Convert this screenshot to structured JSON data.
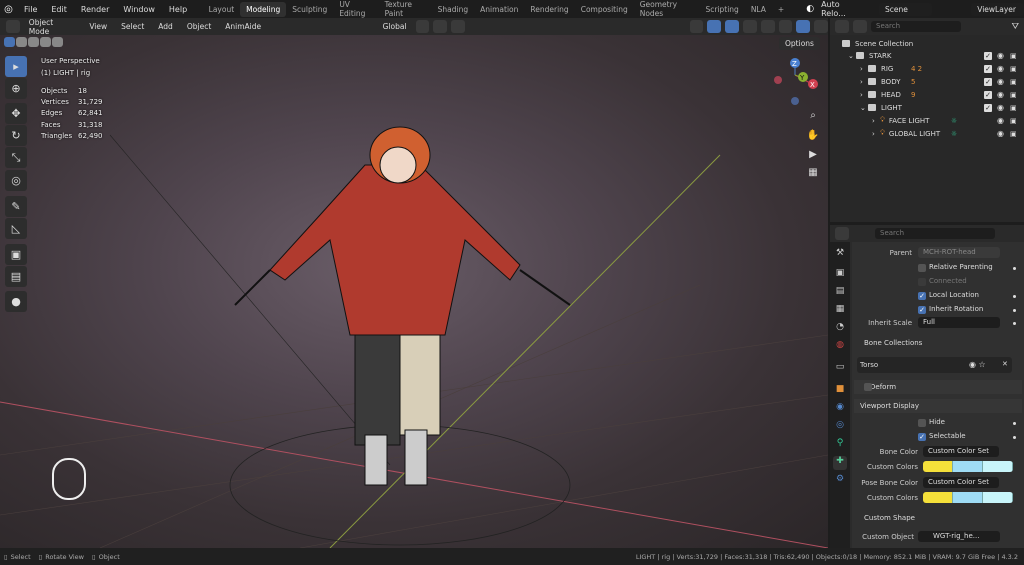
{
  "menu": [
    "File",
    "Edit",
    "Render",
    "Window",
    "Help"
  ],
  "workspaces": [
    "Layout",
    "Modeling",
    "Sculpting",
    "UV Editing",
    "Texture Paint",
    "Shading",
    "Animation",
    "Rendering",
    "Compositing",
    "Geometry Nodes",
    "Scripting",
    "NLA",
    "+"
  ],
  "active_workspace": "Modeling",
  "top_right": {
    "auto_reload": "Auto Relo...",
    "scene": "Scene",
    "view_layer": "ViewLayer"
  },
  "viewport_header": {
    "mode": "Object Mode",
    "items": [
      "View",
      "Select",
      "Add",
      "Object",
      "AnimAide"
    ],
    "orientation": "Global",
    "options": "Options"
  },
  "overlay_text": {
    "perspective": "User Perspective",
    "active": "(1) LIGHT | rig",
    "stats": [
      {
        "label": "Objects",
        "value": "18"
      },
      {
        "label": "Vertices",
        "value": "31,729"
      },
      {
        "label": "Edges",
        "value": "62,841"
      },
      {
        "label": "Faces",
        "value": "31,318"
      },
      {
        "label": "Triangles",
        "value": "62,490"
      }
    ]
  },
  "gizmo": {
    "x": "X",
    "y": "Y",
    "z": "Z"
  },
  "outliner": {
    "search_placeholder": "Search",
    "root": "Scene Collection",
    "items": [
      {
        "name": "STARK",
        "level": 0
      },
      {
        "name": "RIG",
        "level": 1,
        "badge": "4 2"
      },
      {
        "name": "BODY",
        "level": 1,
        "badge": "5"
      },
      {
        "name": "HEAD",
        "level": 1,
        "badge": "9"
      },
      {
        "name": "LIGHT",
        "level": 1
      },
      {
        "name": "FACE LIGHT",
        "level": 2
      },
      {
        "name": "GLOBAL LIGHT",
        "level": 2
      }
    ]
  },
  "properties": {
    "search_placeholder": "Search",
    "parent_label": "Parent",
    "parent_value": "MCH-ROT-head",
    "relative_parenting": "Relative Parenting",
    "connected": "Connected",
    "local_location": "Local Location",
    "inherit_rotation": "Inherit Rotation",
    "inherit_scale_label": "Inherit Scale",
    "inherit_scale_value": "Full",
    "bone_collections": "Bone Collections",
    "collection_item": "Torso",
    "deform": "Deform",
    "viewport_display": "Viewport Display",
    "hide": "Hide",
    "selectable": "Selectable",
    "bone_color_label": "Bone Color",
    "bone_color_value": "Custom Color Set",
    "custom_colors_label": "Custom Colors",
    "pose_bone_color_label": "Pose Bone Color",
    "pose_bone_color_value": "Custom Color Set",
    "custom_shape": "Custom Shape",
    "custom_object_label": "Custom Object",
    "custom_object_value": "WGT-rig_he...",
    "colors": [
      "#f5e03a",
      "#9fdcf5",
      "#c8f5fa"
    ]
  },
  "status": {
    "select": "Select",
    "rotate": "Rotate View",
    "object": "Object",
    "info": "LIGHT | rig | Verts:31,729 | Faces:31,318 | Tris:62,490 | Objects:0/18 | Memory: 852.1 MiB | VRAM: 9.7 GiB Free | 4.3.2"
  }
}
